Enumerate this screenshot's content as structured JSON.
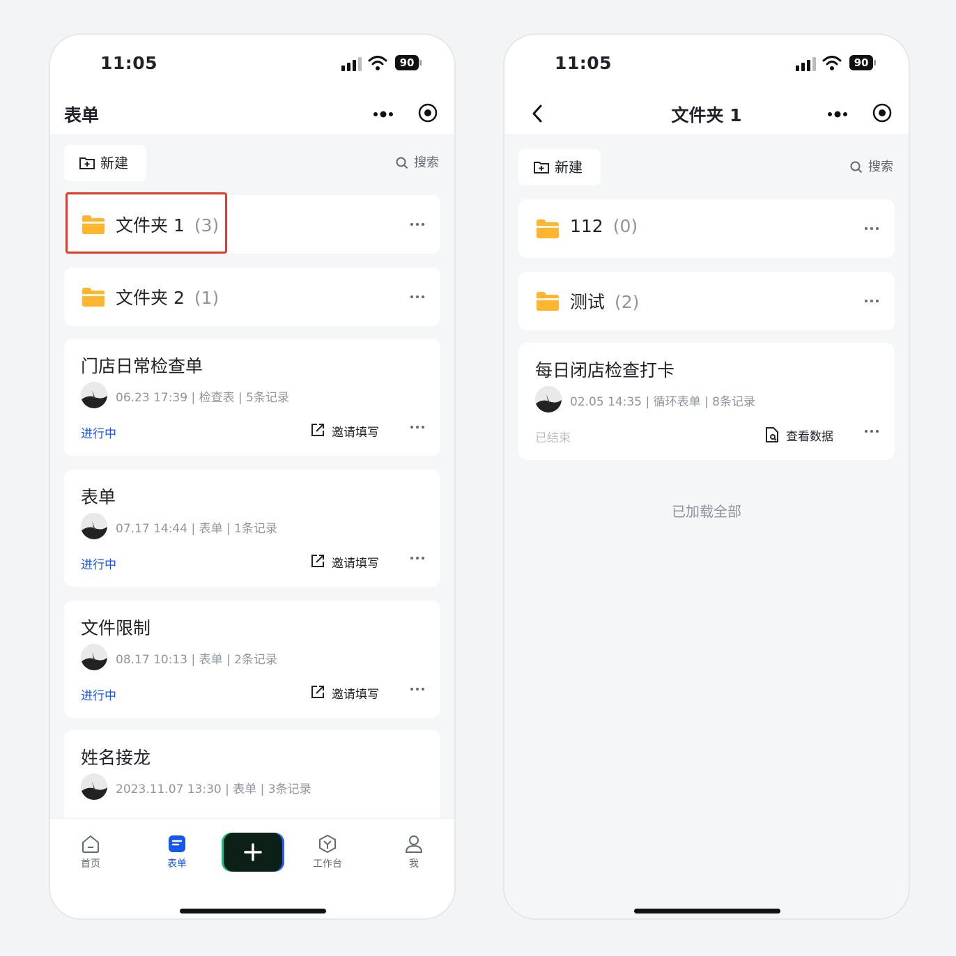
{
  "left_phone": {
    "status_time": "11:05",
    "battery": "90",
    "nav_title": "表单",
    "new_label": "新建",
    "search_label": "搜索",
    "folders": [
      {
        "name": "文件夹 1",
        "count": "(3)"
      },
      {
        "name": "文件夹 2",
        "count": "(1)"
      }
    ],
    "forms": [
      {
        "title": "门店日常检查单",
        "meta": "06.23 17:39 | 检查表 | 5条记录",
        "status": "进行中",
        "action": "邀请填写"
      },
      {
        "title": "表单",
        "meta": "07.17 14:44 | 表单 | 1条记录",
        "status": "进行中",
        "action": "邀请填写"
      },
      {
        "title": "文件限制",
        "meta": "08.17 10:13 | 表单 | 2条记录",
        "status": "进行中",
        "action": "邀请填写"
      },
      {
        "title": "姓名接龙",
        "meta": "2023.11.07 13:30 | 表单 | 3条记录"
      }
    ],
    "tabs": [
      {
        "label": "首页",
        "icon": "home-icon"
      },
      {
        "label": "表单",
        "icon": "form-icon",
        "active": true
      },
      {
        "label": "工作台",
        "icon": "workbench-icon"
      },
      {
        "label": "我",
        "icon": "profile-icon"
      }
    ]
  },
  "right_phone": {
    "status_time": "11:05",
    "battery": "90",
    "nav_title": "文件夹 1",
    "new_label": "新建",
    "search_label": "搜索",
    "folders": [
      {
        "name": "112",
        "count": "(0)"
      },
      {
        "name": "测试",
        "count": "(2)"
      }
    ],
    "forms": [
      {
        "title": "每日闭店检查打卡",
        "meta": "02.05 14:35 | 循环表单 | 8条记录",
        "status": "已结束",
        "action": "查看数据"
      }
    ],
    "footer": "已加载全部"
  },
  "colors": {
    "accent_blue": "#1456f0",
    "highlight_red": "#e8392b",
    "folder_yellow": "#ffb52e"
  }
}
